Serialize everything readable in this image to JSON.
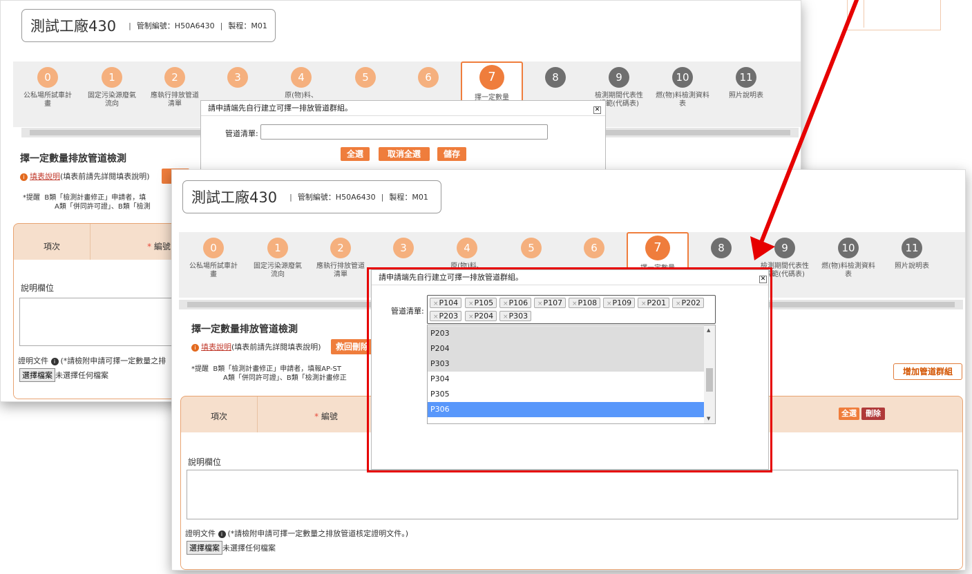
{
  "factory": {
    "name": "測試工廠430",
    "control_no": "管制編號：H50A6430",
    "process": "製程：M01",
    "separator": "|"
  },
  "steps_back": [
    {
      "num": "0",
      "label": "公私場所試車計畫"
    },
    {
      "num": "1",
      "label": "固定污染源廢氣流向"
    },
    {
      "num": "2",
      "label": "應執行排放管道清單"
    },
    {
      "num": "3",
      "label": ""
    },
    {
      "num": "4",
      "label": "原(物)料、"
    },
    {
      "num": "5",
      "label": ""
    },
    {
      "num": "6",
      "label": ""
    },
    {
      "num": "7",
      "label": "擇一定數量"
    },
    {
      "num": "8",
      "label": ""
    },
    {
      "num": "9",
      "label": "檢測期間代表性規範(代碼表)"
    },
    {
      "num": "10",
      "label": "燃(物)料檢測資料表"
    },
    {
      "num": "11",
      "label": "照片說明表"
    }
  ],
  "steps_front": [
    {
      "num": "0",
      "label": "公私場所試車計畫"
    },
    {
      "num": "1",
      "label": "固定污染源廢氣流向"
    },
    {
      "num": "2",
      "label": "應執行排放管道清單"
    },
    {
      "num": "3",
      "label": ""
    },
    {
      "num": "4",
      "label": "原(物)料、"
    },
    {
      "num": "5",
      "label": ""
    },
    {
      "num": "6",
      "label": ""
    },
    {
      "num": "7",
      "label": "擇一定數量"
    },
    {
      "num": "8",
      "label": ""
    },
    {
      "num": "9",
      "label": "檢測期間代表性規範(代碼表)"
    },
    {
      "num": "10",
      "label": "燃(物)料檢測資料表"
    },
    {
      "num": "11",
      "label": "照片說明表"
    }
  ],
  "section": {
    "title": "擇一定數量排放管道檢測",
    "help_link": "填表說明",
    "help_note": "(填表前請先詳閱填表說明)",
    "return_button": "救回刪除",
    "tip_prefix": "*提醒",
    "tip_line1": "B類「檢測計畫修正」申請者，填報AP-ST",
    "tip_line2": "A類「併同許可證」、B類「檢測計畫修正",
    "back_tip_line1": "B類「檢測計畫修正」申請者，填",
    "back_tip_line2": "A類「併同許可證」、B類「檢測"
  },
  "table": {
    "col_item": "項次",
    "col_no": "編號",
    "required_mark": "*",
    "select_all": "全選",
    "delete": "刪除"
  },
  "desc": {
    "label": "說明欄位",
    "doc_label": "證明文件",
    "doc_note": "(*請檢附申請可擇一定數量之排放管道核定證明文件。)",
    "back_doc_note": "(*請檢附申請可擇一定數量之排",
    "file_button": "選擇檔案",
    "file_status": "未選擇任何檔案"
  },
  "add_group_button": "增加管道群組",
  "dialog_back": {
    "title": "請申請端先自行建立可擇一排放管道群組。",
    "field_label": "管道清單:",
    "btn_select_all": "全選",
    "btn_cancel_all": "取消全選",
    "btn_save": "儲存"
  },
  "dialog_front": {
    "title": "請申請端先自行建立可擇一排放管道群組。",
    "field_label": "管道清單:",
    "chips": [
      "P104",
      "P105",
      "P106",
      "P107",
      "P108",
      "P109",
      "P201",
      "P202",
      "P203",
      "P204",
      "P303"
    ],
    "chip_remove": "×",
    "options": [
      "P203",
      "P204",
      "P303",
      "P304",
      "P305",
      "P306"
    ],
    "selected_options": [
      "P203",
      "P204",
      "P303"
    ],
    "highlighted_option": "P306"
  },
  "colors": {
    "accent": "#ef7d3c",
    "callout_red": "#e60000",
    "delete_btn": "#b03a3a"
  }
}
